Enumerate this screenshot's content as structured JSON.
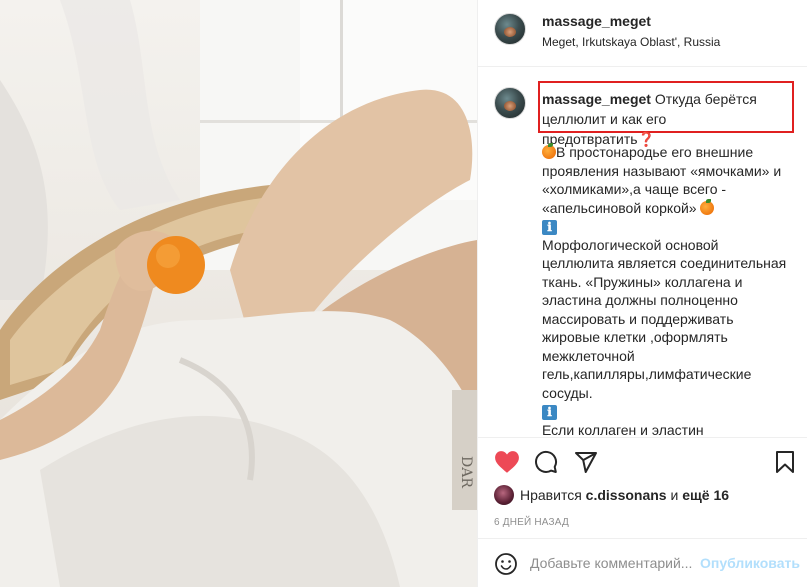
{
  "header": {
    "username": "massage_meget",
    "location": "Meget, Irkutskaya Oblast', Russia"
  },
  "caption": {
    "username": "massage_meget",
    "title": "Откуда берётся целлюлит и как его предотвратить",
    "title_emoji": "❓",
    "para1": "В простонародье его внешние проявления называют «ямочками» и «холмиками»,а чаще всего - «апельсиновой коркой»",
    "info_emoji": "ℹ",
    "para2": "Морфологической основой целлюлита является соединительная ткань. «Пружины» коллагена и эластина должны полноценно массировать и поддерживать жировые клетки ,оформлять межклеточной гель,капилляры,лимфатические сосуды.",
    "para3": "Если коллаген и эластин"
  },
  "photo": {
    "book_text": "DAR"
  },
  "actions": {
    "icons": [
      "heart-icon",
      "comment-icon",
      "share-icon",
      "bookmark-icon"
    ],
    "liked_color": "#ed4956"
  },
  "likes": {
    "prefix": "Нравится",
    "user": "c.dissonans",
    "conj": "и",
    "others": "ещё 16"
  },
  "timestamp": "6 ДНЕЙ НАЗАД",
  "comment": {
    "placeholder": "Добавьте комментарий...",
    "publish": "Опубликовать"
  }
}
